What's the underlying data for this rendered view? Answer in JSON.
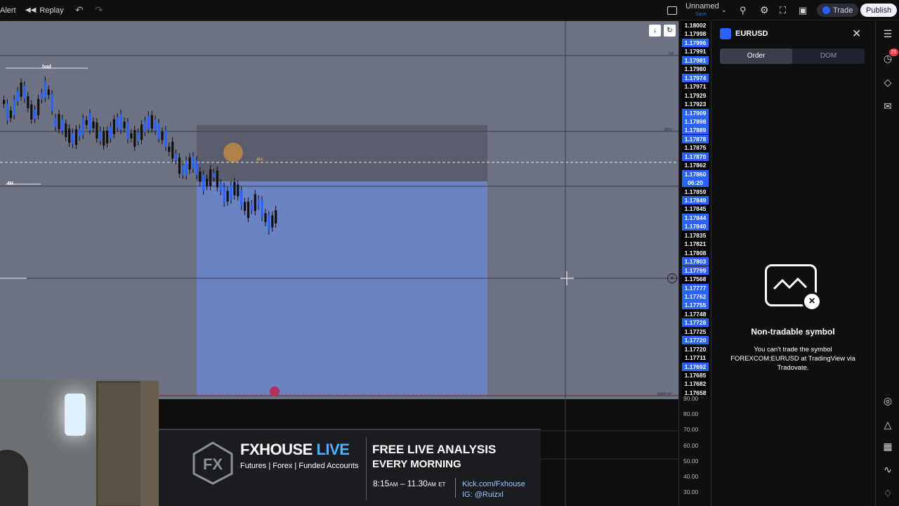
{
  "topbar": {
    "alert_label": "Alert",
    "replay_label": "Replay",
    "layout_name": "Unnamed",
    "layout_status": "Save",
    "trade_label": "Trade",
    "publish_label": "Publish"
  },
  "chart": {
    "labels": {
      "hod": "hod",
      "h4": "4H",
      "dms": "dms",
      "hd": "hd",
      "open_w": "open-w"
    },
    "marker": "4H"
  },
  "price_axis": {
    "prices": [
      {
        "v": "1.18002",
        "c": "#000000"
      },
      {
        "v": "1.17998",
        "c": "#000000"
      },
      {
        "v": "1.17996",
        "c": "#2962ff"
      },
      {
        "v": "1.17991",
        "c": "#000000"
      },
      {
        "v": "1.17981",
        "c": "#2962ff"
      },
      {
        "v": "1.17980",
        "c": "#000000"
      },
      {
        "v": "1.17974",
        "c": "#2962ff"
      },
      {
        "v": "1.17971",
        "c": "#000000"
      },
      {
        "v": "1.17929",
        "c": "#000000"
      },
      {
        "v": "1.17923",
        "c": "#000000"
      },
      {
        "v": "1.17909",
        "c": "#2962ff"
      },
      {
        "v": "1.17898",
        "c": "#2962ff"
      },
      {
        "v": "1.17889",
        "c": "#2962ff"
      },
      {
        "v": "1.17878",
        "c": "#2962ff"
      },
      {
        "v": "1.17875",
        "c": "#000000"
      },
      {
        "v": "1.17870",
        "c": "#2962ff"
      },
      {
        "v": "1.17862",
        "c": "#000000"
      },
      {
        "v": "1.17860",
        "c": "#2962ff"
      },
      {
        "v": "06:20",
        "c": "#2962ff"
      },
      {
        "v": "1.17859",
        "c": "#000000"
      },
      {
        "v": "1.17849",
        "c": "#2962ff"
      },
      {
        "v": "1.17845",
        "c": "#000000"
      },
      {
        "v": "1.17844",
        "c": "#2962ff"
      },
      {
        "v": "1.17840",
        "c": "#2962ff"
      },
      {
        "v": "1.17835",
        "c": "#000000"
      },
      {
        "v": "1.17821",
        "c": "#000000"
      },
      {
        "v": "1.17808",
        "c": "#000000"
      },
      {
        "v": "1.17803",
        "c": "#2962ff"
      },
      {
        "v": "1.17799",
        "c": "#2962ff"
      },
      {
        "v": "1.17568",
        "c": "#000000"
      },
      {
        "v": "1.17777",
        "c": "#2962ff"
      },
      {
        "v": "1.17762",
        "c": "#2962ff"
      },
      {
        "v": "1.17755",
        "c": "#2962ff"
      },
      {
        "v": "1.17748",
        "c": "#000000"
      },
      {
        "v": "1.17728",
        "c": "#2962ff"
      },
      {
        "v": "1.17725",
        "c": "#000000"
      },
      {
        "v": "1.17720",
        "c": "#2962ff"
      },
      {
        "v": "1.17720",
        "c": "#000000"
      },
      {
        "v": "1.17711",
        "c": "#000000"
      },
      {
        "v": "1.17692",
        "c": "#2962ff"
      },
      {
        "v": "1.17685",
        "c": "#000000"
      },
      {
        "v": "1.17682",
        "c": "#000000"
      },
      {
        "v": "1.17658",
        "c": "#000000"
      }
    ],
    "osc_values": [
      "90.00",
      "80.00",
      "70.00",
      "60.00",
      "50.00",
      "40.00",
      "30.00"
    ]
  },
  "panel": {
    "symbol": "EURUSD",
    "tab_order": "Order",
    "tab_dom": "DOM",
    "msg_title": "Non-tradable symbol",
    "msg_line1": "You can't trade the symbol",
    "msg_line2": "FOREXCOM:EURUSD at TradingView via",
    "msg_line3": "Tradovate."
  },
  "sidebar": {
    "notification_count": "25"
  },
  "banner": {
    "brand_a": "FXHOUSE",
    "brand_b": "LIVE",
    "tagline": "Futures | Forex | Funded Accounts",
    "headline1": "FREE LIVE ANALYSIS",
    "headline2": "EVERY MORNING",
    "time_start": "8:15",
    "am1": "AM",
    "dash": " – ",
    "time_end": "11.30",
    "am2": "AM",
    "tz": "ET",
    "kick": "Kick.com/Fxhouse",
    "ig": "IG: @Ruizxl"
  },
  "colors": {
    "blue": "#2962ff",
    "accent_orange": "#f0a030",
    "zone_blue": "#6e84c2",
    "zone_gray": "#5c6070"
  }
}
